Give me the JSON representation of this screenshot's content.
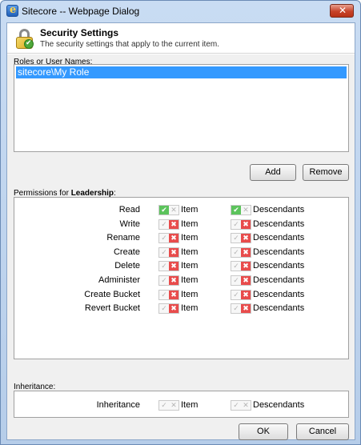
{
  "window": {
    "title": "Sitecore -- Webpage Dialog",
    "close_label": "✕"
  },
  "header": {
    "title": "Security Settings",
    "subtitle": "The security settings that apply to the current item."
  },
  "roles": {
    "label": "Roles or User Names:",
    "items": [
      "sitecore\\My Role"
    ]
  },
  "buttons": {
    "add": "Add",
    "remove": "Remove",
    "ok": "OK",
    "cancel": "Cancel"
  },
  "permissions": {
    "label_prefix": "Permissions for ",
    "label_target": "Leadership",
    "label_suffix": ":",
    "item_label": "Item",
    "descendants_label": "Descendants",
    "rows": [
      {
        "name": "Read",
        "item": "allow",
        "descendants": "allow"
      },
      {
        "name": "Write",
        "item": "deny",
        "descendants": "deny"
      },
      {
        "name": "Rename",
        "item": "deny",
        "descendants": "deny"
      },
      {
        "name": "Create",
        "item": "deny",
        "descendants": "deny"
      },
      {
        "name": "Delete",
        "item": "deny",
        "descendants": "deny"
      },
      {
        "name": "Administer",
        "item": "deny",
        "descendants": "deny"
      },
      {
        "name": "Create Bucket",
        "item": "deny",
        "descendants": "deny"
      },
      {
        "name": "Revert Bucket",
        "item": "deny",
        "descendants": "deny"
      }
    ]
  },
  "inheritance": {
    "label": "Inheritance:",
    "row": {
      "name": "Inheritance",
      "item": "none",
      "descendants": "none"
    },
    "item_label": "Item",
    "descendants_label": "Descendants"
  },
  "colors": {
    "allow": "#5cc35c",
    "deny": "#e84c4c",
    "selection": "#3399ff"
  },
  "icons": {
    "allow": "✔",
    "deny": "✖"
  }
}
